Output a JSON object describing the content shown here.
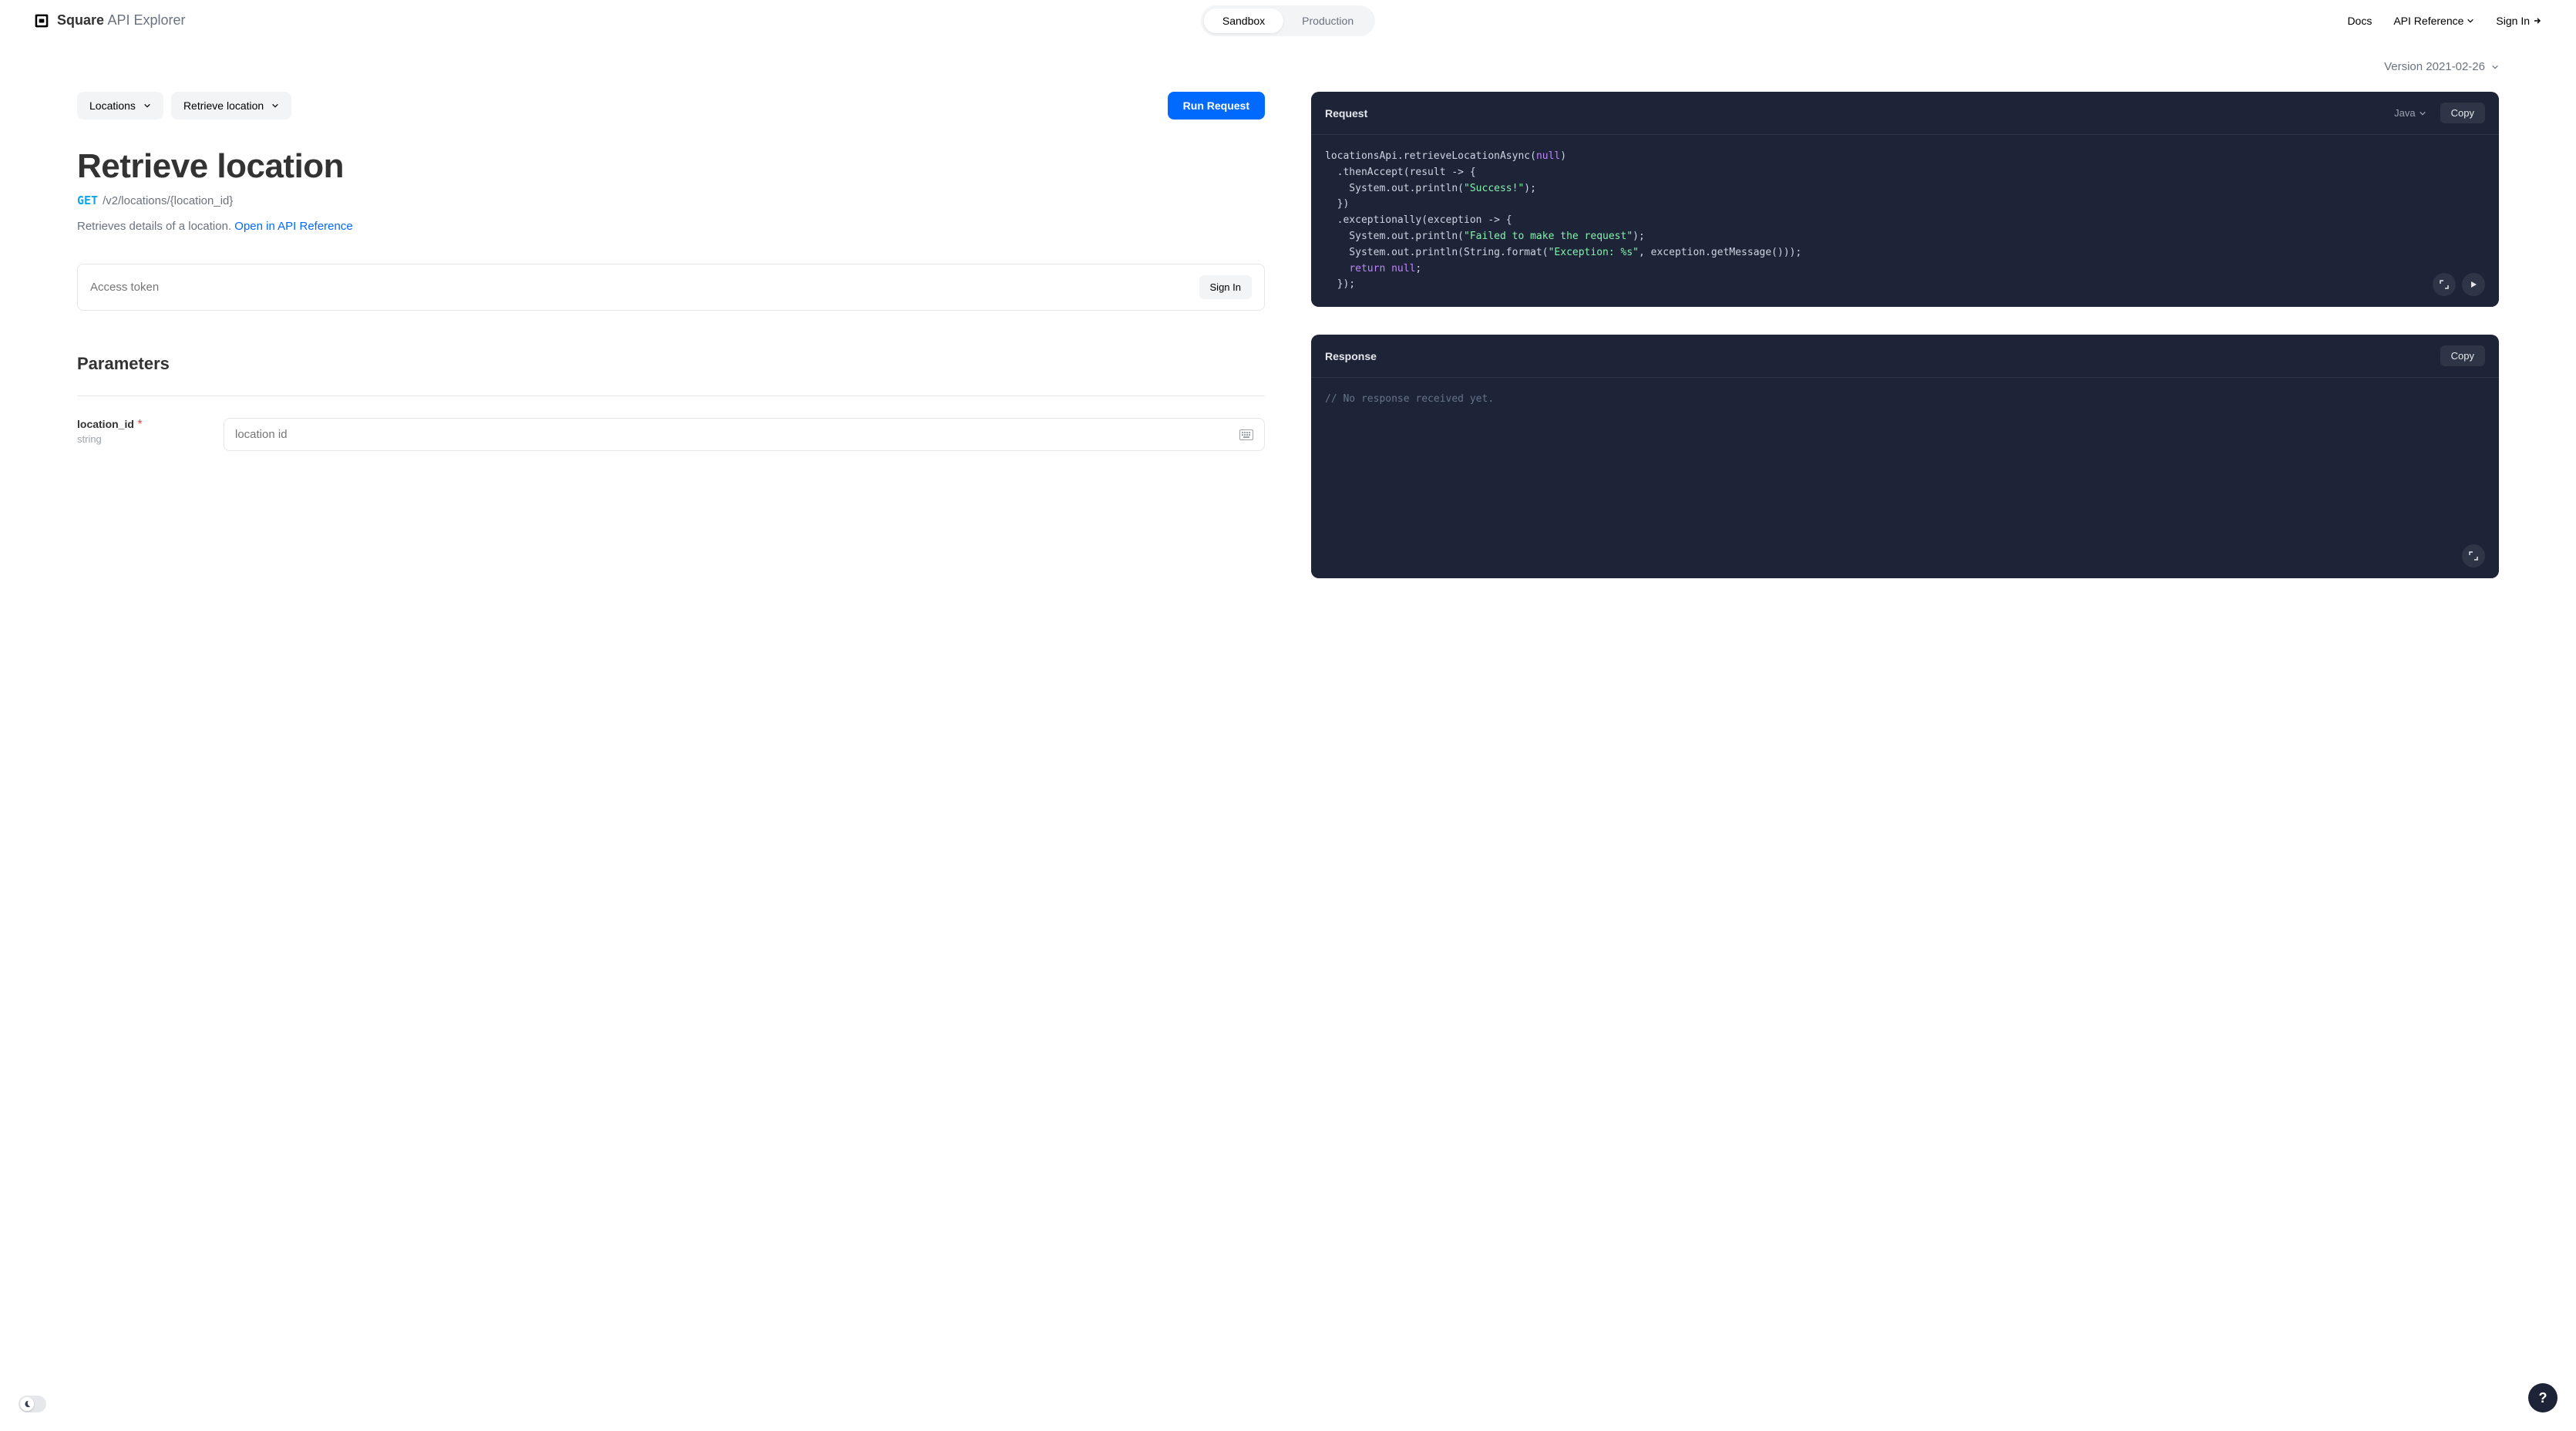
{
  "header": {
    "brand": "Square",
    "brand_sub": "API Explorer",
    "env": {
      "sandbox": "Sandbox",
      "production": "Production",
      "active": "sandbox"
    },
    "nav": {
      "docs": "Docs",
      "api_ref": "API Reference",
      "sign_in": "Sign In"
    }
  },
  "version": {
    "label": "Version 2021-02-26"
  },
  "controls": {
    "api_select": "Locations",
    "endpoint_select": "Retrieve location",
    "run_label": "Run Request"
  },
  "page": {
    "title": "Retrieve location",
    "method": "GET",
    "path": "/v2/locations/{location_id}",
    "description": "Retrieves details of a location. ",
    "ref_link": "Open in API Reference"
  },
  "token": {
    "placeholder": "Access token",
    "signin_label": "Sign In"
  },
  "parameters": {
    "section_title": "Parameters",
    "items": [
      {
        "name": "location_id",
        "required": true,
        "type": "string",
        "placeholder": "location id"
      }
    ]
  },
  "request_panel": {
    "title": "Request",
    "language": "Java",
    "copy_label": "Copy",
    "code": {
      "l1a": "locationsApi.retrieveLocationAsync(",
      "l1_null": "null",
      "l1b": ")",
      "l2": "  .thenAccept(result -> {",
      "l3a": "    System.out.println(",
      "l3_str": "\"Success!\"",
      "l3b": ");",
      "l4": "  })",
      "l5": "  .exceptionally(exception -> {",
      "l6a": "    System.out.println(",
      "l6_str": "\"Failed to make the request\"",
      "l6b": ");",
      "l7a": "    System.out.println(String.format(",
      "l7_str": "\"Exception: %s\"",
      "l7b": ", exception.getMessage()));",
      "l8a": "    ",
      "l8_kw": "return",
      "l8b": " ",
      "l8_null": "null",
      "l8c": ";",
      "l9": "  });"
    }
  },
  "response_panel": {
    "title": "Response",
    "copy_label": "Copy",
    "body": "// No response received yet."
  },
  "help": {
    "label": "?"
  }
}
